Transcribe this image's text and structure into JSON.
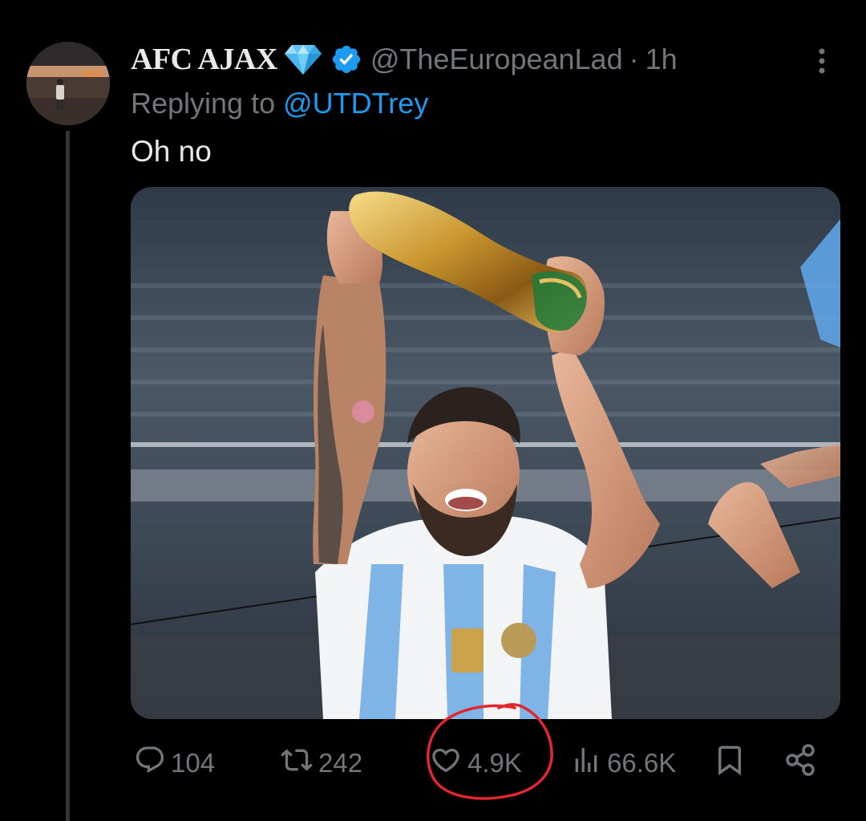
{
  "tweet": {
    "display_name": "AFC AJAX",
    "name_emoji": "gem-emoji",
    "verified": true,
    "handle": "@TheEuropeanLad",
    "separator": "·",
    "time": "1h",
    "reply_prefix": "Replying to",
    "reply_to": "@UTDTrey",
    "text": "Oh no"
  },
  "actions": {
    "replies": "104",
    "retweets": "242",
    "likes": "4.9K",
    "views": "66.6K"
  },
  "icons": {
    "more": "more-vertical-icon",
    "reply": "reply-icon",
    "retweet": "retweet-icon",
    "like": "heart-icon",
    "views": "views-icon",
    "bookmark": "bookmark-icon",
    "share": "share-icon"
  },
  "colors": {
    "background": "#000000",
    "primary_text": "#e7e9ea",
    "secondary_text": "#71767b",
    "link": "#1d9bf0",
    "verified": "#1d9bf0",
    "annotation_circle": "#e0262f"
  }
}
